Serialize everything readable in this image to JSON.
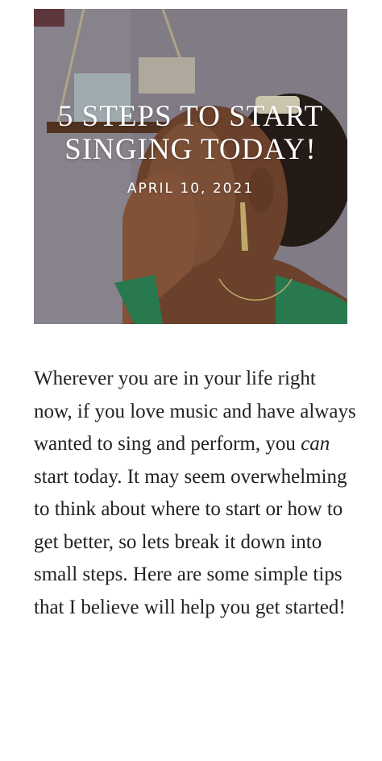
{
  "post": {
    "title": "5 STEPS TO START SINGING TODAY!",
    "date": "APRIL 10, 2021",
    "intro_before": "Wherever you are in your life right now, if you love music and have always wanted to sing and perform, you ",
    "intro_emphasis": "can",
    "intro_after": " start today. It may seem overwhelming to think about where to start or how to get better, so lets break it down into small steps. Here are some simple tips that I believe will help you get started!"
  },
  "colors": {
    "text": "#222222",
    "overlay_text": "#ffffff",
    "background": "#ffffff"
  }
}
